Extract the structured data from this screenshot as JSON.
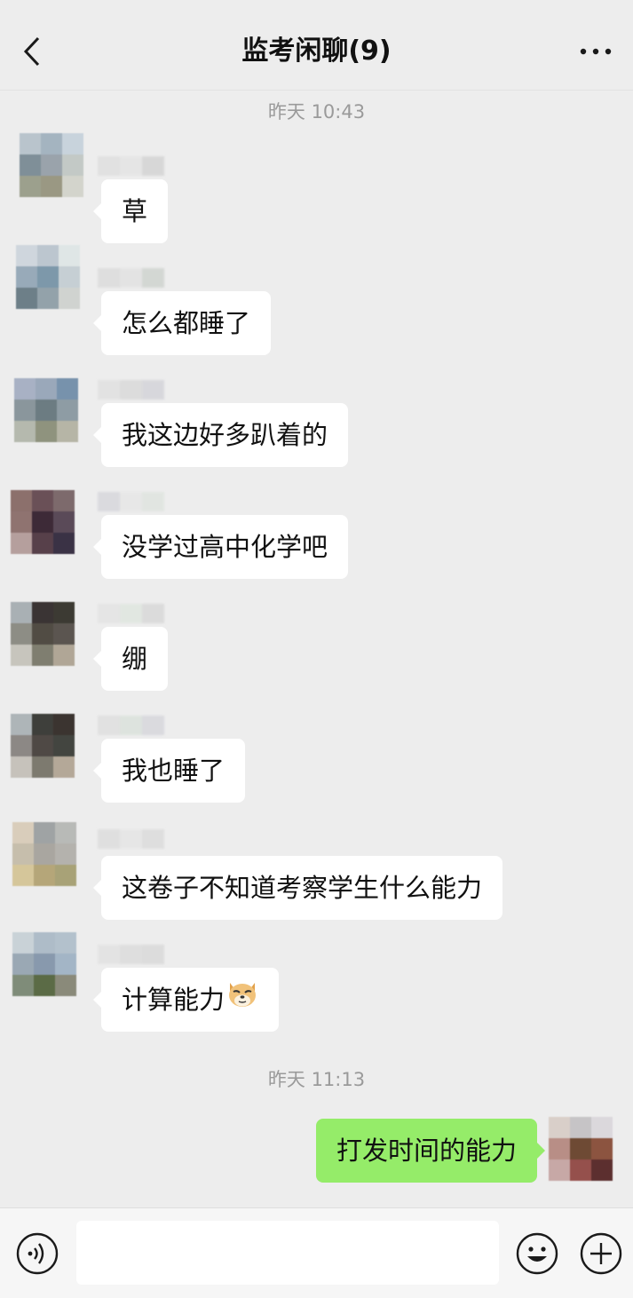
{
  "header": {
    "title": "监考闲聊(9)",
    "back_icon": "chevron-left-icon",
    "more_icon": "ellipsis-icon"
  },
  "timestamps": [
    "昨天 10:43",
    "昨天 11:13"
  ],
  "messages": [
    {
      "side": "left",
      "text": "草"
    },
    {
      "side": "left",
      "text": "怎么都睡了"
    },
    {
      "side": "left",
      "text": "我这边好多趴着的"
    },
    {
      "side": "left",
      "text": "没学过高中化学吧"
    },
    {
      "side": "left",
      "text": "绷"
    },
    {
      "side": "left",
      "text": "我也睡了"
    },
    {
      "side": "left",
      "text": "这卷子不知道考察学生什么能力"
    },
    {
      "side": "left",
      "text": "计算能力",
      "emoji": "doge-icon"
    },
    {
      "side": "right",
      "text": "打发时间的能力"
    }
  ],
  "input": {
    "value": "",
    "placeholder": "",
    "voice_icon": "voice-icon",
    "emoji_icon": "smiley-icon",
    "plus_icon": "plus-icon"
  },
  "colors": {
    "background": "#ededed",
    "incoming_bubble": "#ffffff",
    "outgoing_bubble": "#95ec69",
    "timestamp": "#9a9a9a"
  }
}
